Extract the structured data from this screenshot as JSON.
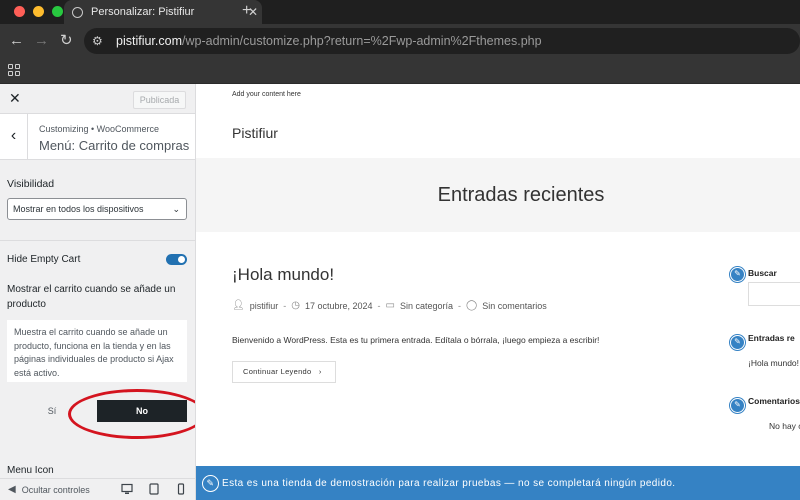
{
  "browser": {
    "tab_title": "Personalizar: Pistifiur",
    "tab_close": "✕",
    "new_tab": "+",
    "url_host": "pistifiur.com",
    "url_path": "/wp-admin/customize.php?return=%2Fwp-admin%2Fthemes.php",
    "traffic_colors": [
      "#ff5f57",
      "#febc2e",
      "#28c840"
    ]
  },
  "sidebar": {
    "close": "✕",
    "publish_label": "Publicada",
    "back": "‹",
    "breadcrumb": "Customizing • WooCommerce",
    "section_title": "Menú: Carrito de compras",
    "visibility_label": "Visibilidad",
    "visibility_value": "Mostrar en todos los dispositivos",
    "hide_empty_cart_label": "Hide Empty Cart",
    "hide_empty_cart_on": true,
    "show_cart_label": "Mostrar el carrito cuando se añade un producto",
    "show_cart_description": "Muestra el carrito cuando se añade un producto, funciona en la tienda y en las páginas individuales de producto si Ajax está activo.",
    "option_yes": "Sí",
    "option_no": "No",
    "selected_option": "No",
    "next_section_label": "Menu Icon",
    "hide_controls_label": "Ocultar controles"
  },
  "preview": {
    "topbar_text": "Add your content here",
    "site_title": "Pistifiur",
    "hero_title": "Entradas recientes",
    "post_title": "¡Hola mundo!",
    "post_author": "pistifiur",
    "post_date": "17 octubre, 2024",
    "post_category": "Sin categoría",
    "post_comments": "Sin comentarios",
    "post_excerpt": "Bienvenido a WordPress. Esta es tu primera entrada. Edítala o bórrala, ¡luego empieza a escribir!",
    "read_more": "Continuar Leyendo",
    "widget_search_title": "Buscar",
    "widget_recent_title": "Entradas re",
    "widget_recent_item": "¡Hola mundo!",
    "widget_comments_title": "Comentarios",
    "widget_comments_text": "No hay c",
    "demo_banner": "Esta es una tienda de demostración para realizar pruebas — no se completará ningún pedido."
  }
}
